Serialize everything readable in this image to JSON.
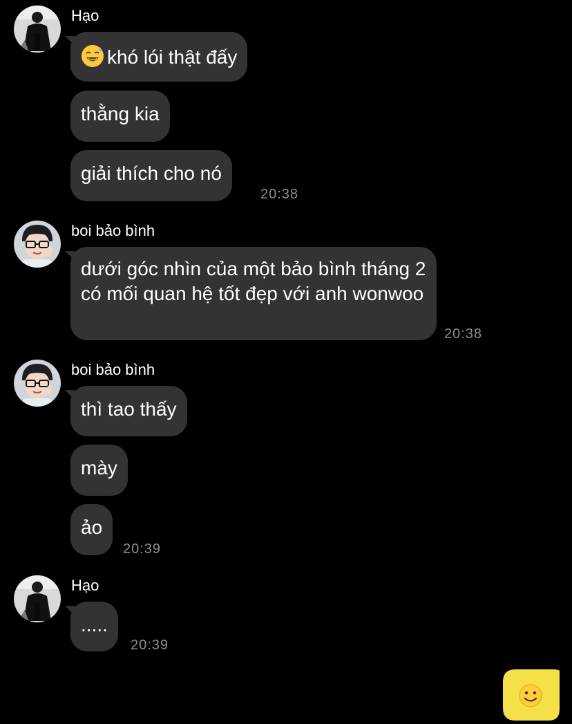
{
  "groups": [
    {
      "sender": "Hạo",
      "avatar": "avatar-hao",
      "messages": [
        {
          "text": "khó lói thật đấy",
          "emoji": "sweat-smile-emoji"
        },
        {
          "text": "thằng kia"
        },
        {
          "text": "giải thích cho nó"
        }
      ],
      "time": "20:38"
    },
    {
      "sender": "boi bảo bình",
      "avatar": "avatar-boi-bao-binh",
      "messages": [
        {
          "text": "dưới góc nhìn của một bảo bình tháng 2 có mối quan hệ tốt đẹp với anh wonwoo"
        }
      ],
      "time": "20:38"
    },
    {
      "sender": "boi bảo bình",
      "avatar": "avatar-boi-bao-binh",
      "messages": [
        {
          "text": "thì tao thấy"
        },
        {
          "text": "mày"
        },
        {
          "text": "ảo"
        }
      ],
      "time": "20:39"
    },
    {
      "sender": "Hạo",
      "avatar": "avatar-hao",
      "messages": [
        {
          "text": "....."
        }
      ],
      "time": "20:39"
    }
  ],
  "compose_button": {
    "icon": "smile-icon",
    "color": "#F5E04A"
  },
  "colors": {
    "background": "#000000",
    "bubble": "#333336",
    "time": "#8E8E93",
    "accent": "#F5E04A"
  }
}
